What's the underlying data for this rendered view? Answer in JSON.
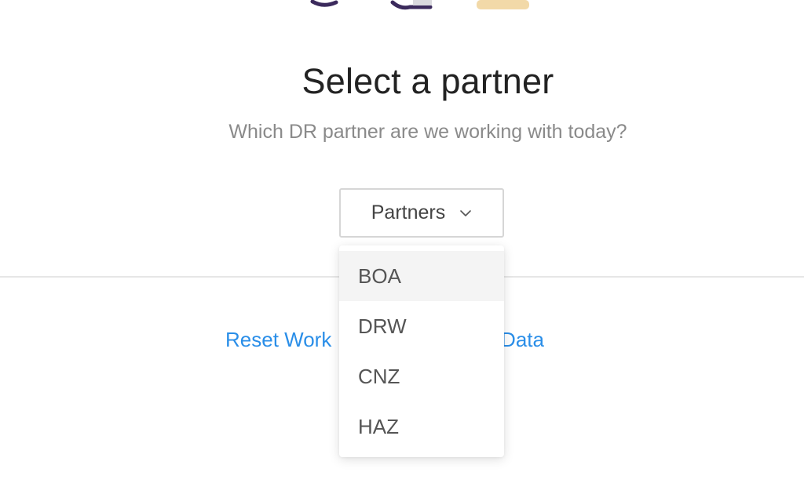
{
  "header": {
    "title": "Select a partner",
    "subtitle": "Which DR partner are we working with today?"
  },
  "dropdown": {
    "label": "Partners",
    "icon": "chevron-down-icon",
    "options": [
      "BOA",
      "DRW",
      "CNZ",
      "HAZ"
    ],
    "highlighted_option": "BOA"
  },
  "footer": {
    "reset_link": "Reset Work",
    "example_link": "xample Data"
  },
  "colors": {
    "link": "#2a8ee8",
    "title": "#222222",
    "subtitle": "#8a8a8a",
    "illustration_purple": "#3b2a5c",
    "illustration_tan": "#f2d9a8"
  }
}
